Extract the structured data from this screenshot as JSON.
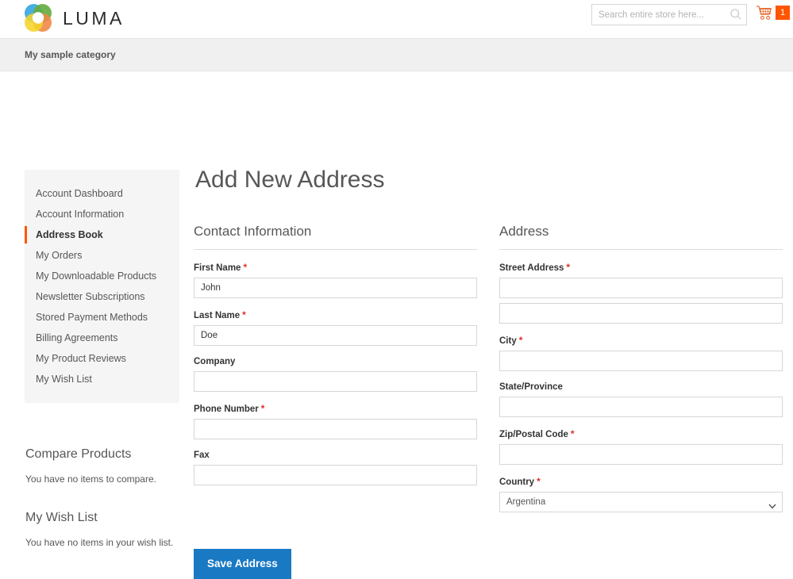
{
  "header": {
    "logo_text": "LUMA",
    "logo_colors": {
      "top_left": "#3aa9e0",
      "top_right": "#5aa632",
      "bottom_right": "#ee7d38",
      "bottom_left": "#f3d118"
    },
    "search": {
      "placeholder": "Search entire store here...",
      "value": "",
      "icon": "search-icon"
    },
    "cart": {
      "icon": "shopping-cart-icon",
      "count": "1",
      "badge_color": "#ff5501"
    }
  },
  "navbar": {
    "items": [
      {
        "label": "My sample category"
      }
    ]
  },
  "sidebar": {
    "nav_items": [
      {
        "label": "Account Dashboard",
        "active": false
      },
      {
        "label": "Account Information",
        "active": false
      },
      {
        "label": "Address Book",
        "active": true
      },
      {
        "label": "My Orders",
        "active": false
      },
      {
        "label": "My Downloadable Products",
        "active": false
      },
      {
        "label": "Newsletter Subscriptions",
        "active": false
      },
      {
        "label": "Stored Payment Methods",
        "active": false
      },
      {
        "label": "Billing Agreements",
        "active": false
      },
      {
        "label": "My Product Reviews",
        "active": false
      },
      {
        "label": "My Wish List",
        "active": false
      }
    ],
    "compare_products": {
      "title": "Compare Products",
      "empty_text": "You have no items to compare."
    },
    "wish_list": {
      "title": "My Wish List",
      "empty_text": "You have no items in your wish list."
    },
    "active_marker_color": "#ff5501"
  },
  "main": {
    "page_title": "Add New Address",
    "contact_section": {
      "legend": "Contact Information",
      "fields": {
        "first_name": {
          "label": "First Name",
          "required": true,
          "value": "John",
          "placeholder": ""
        },
        "last_name": {
          "label": "Last Name",
          "required": true,
          "value": "Doe",
          "placeholder": ""
        },
        "company": {
          "label": "Company",
          "required": false,
          "value": "",
          "placeholder": ""
        },
        "phone": {
          "label": "Phone Number",
          "required": true,
          "value": "",
          "placeholder": ""
        },
        "fax": {
          "label": "Fax",
          "required": false,
          "value": "",
          "placeholder": ""
        }
      }
    },
    "address_section": {
      "legend": "Address",
      "fields": {
        "street": {
          "label": "Street Address",
          "required": true,
          "value_line1": "",
          "value_line2": "",
          "placeholder": ""
        },
        "city": {
          "label": "City",
          "required": true,
          "value": "",
          "placeholder": ""
        },
        "state": {
          "label": "State/Province",
          "required": false,
          "value": "",
          "placeholder": ""
        },
        "zip": {
          "label": "Zip/Postal Code",
          "required": true,
          "value": "",
          "placeholder": ""
        },
        "country": {
          "label": "Country",
          "required": true,
          "selected": "Argentina",
          "options": [
            "Argentina"
          ],
          "chevron_icon": "chevron-down-icon"
        }
      }
    },
    "save_button": {
      "label": "Save Address",
      "color": "#1979c3"
    },
    "required_marker": "*"
  }
}
